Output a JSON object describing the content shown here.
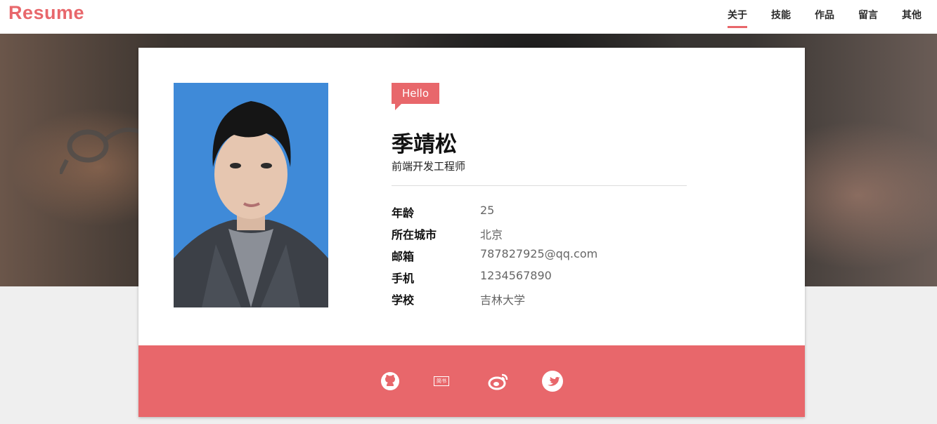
{
  "header": {
    "logo": "Resume",
    "nav": [
      {
        "label": "关于",
        "active": true
      },
      {
        "label": "技能",
        "active": false
      },
      {
        "label": "作品",
        "active": false
      },
      {
        "label": "留言",
        "active": false
      },
      {
        "label": "其他",
        "active": false
      }
    ]
  },
  "profile": {
    "badge": "Hello",
    "name": "季靖松",
    "title": "前端开发工程师",
    "fields": [
      {
        "label": "年龄",
        "value": "25"
      },
      {
        "label": "所在城市",
        "value": "北京"
      },
      {
        "label": "邮箱",
        "value": "787827925@qq.com"
      },
      {
        "label": "手机",
        "value": "1234567890"
      },
      {
        "label": "学校",
        "value": "吉林大学"
      }
    ]
  },
  "footer": {
    "social": [
      {
        "icon": "github-icon"
      },
      {
        "icon": "jianshu-icon",
        "text": "简书"
      },
      {
        "icon": "weibo-icon"
      },
      {
        "icon": "twitter-icon"
      }
    ]
  },
  "colors": {
    "accent": "#e8676b",
    "photo_bg": "#3f8ad8",
    "page_bg": "#efefef"
  }
}
